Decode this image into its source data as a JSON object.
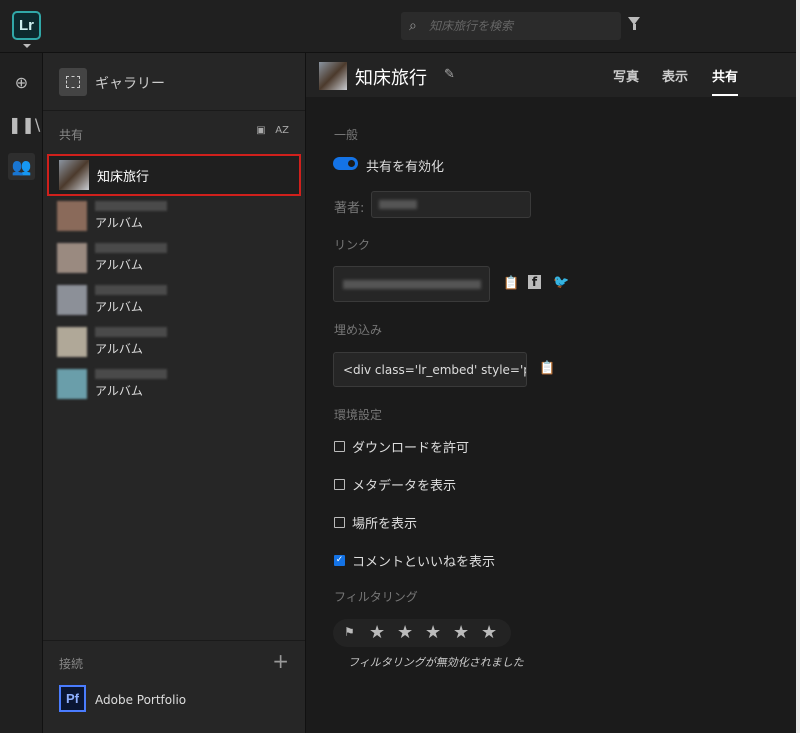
{
  "app": {
    "logo": "Lr",
    "search_placeholder": "知床旅行を検索"
  },
  "sidebar": {
    "gallery": "ギャラリー",
    "shared_header": "共有",
    "sort_label": "AZ",
    "albums": [
      {
        "name": "知床旅行",
        "selected": true
      },
      {
        "sub": "アルバム"
      },
      {
        "sub": "アルバム"
      },
      {
        "sub": "アルバム"
      },
      {
        "sub": "アルバム"
      },
      {
        "sub": "アルバム"
      }
    ],
    "connect_header": "接続",
    "portfolio_icon": "Pf",
    "portfolio": "Adobe Portfolio"
  },
  "main": {
    "title": "知床旅行",
    "tabs": [
      "写真",
      "表示",
      "共有"
    ],
    "active_tab": "共有",
    "general": "一般",
    "enable_sharing": "共有を有効化",
    "author_label": "著者:",
    "link_label": "リンク",
    "embed_label": "埋め込み",
    "embed_value": "<div class='lr_embed' style='p …",
    "prefs_label": "環境設定",
    "options": [
      {
        "label": "ダウンロードを許可",
        "checked": false
      },
      {
        "label": "メタデータを表示",
        "checked": false
      },
      {
        "label": "場所を表示",
        "checked": false
      },
      {
        "label": "コメントといいねを表示",
        "checked": true
      }
    ],
    "filtering_label": "フィルタリング",
    "filtering_note": "フィルタリングが無効化されました"
  },
  "colors": {
    "accent": "#1473e6",
    "selection": "#d0201c"
  }
}
